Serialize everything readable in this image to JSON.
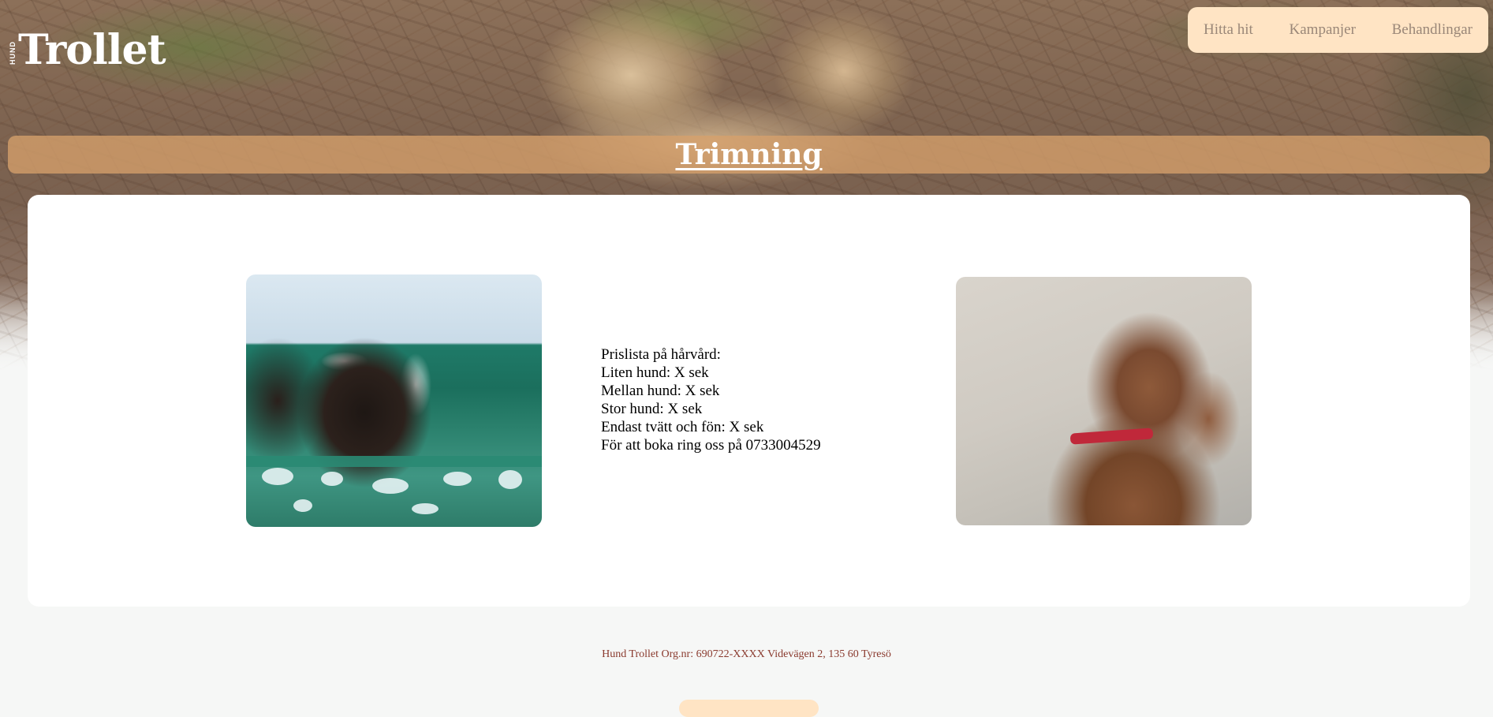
{
  "brand": {
    "logo_small": "HUND",
    "logo_text": "Trollet"
  },
  "nav": {
    "items": [
      {
        "label": "Hitta hit"
      },
      {
        "label": "Kampanjer"
      },
      {
        "label": "Behandlingar"
      }
    ]
  },
  "page": {
    "title": "Trimning"
  },
  "content": {
    "price_lines": [
      "Prislista på hårvård:",
      "Liten hund: X sek",
      "Mellan hund: X sek",
      "Stor hund: X sek",
      "Endast tvätt och fön: X sek",
      "För att boka ring oss på 0733004529"
    ]
  },
  "footer": {
    "text": "Hund Trollet Org.nr: 690722-XXXX Videvägen 2, 135 60 Tyresö"
  },
  "colors": {
    "nav_bg": "#ffe4c4",
    "nav_text": "#9a8778",
    "title_band": "#d6a06c",
    "footer_text": "#8a3a2e",
    "page_bg": "#f6f7f6"
  }
}
